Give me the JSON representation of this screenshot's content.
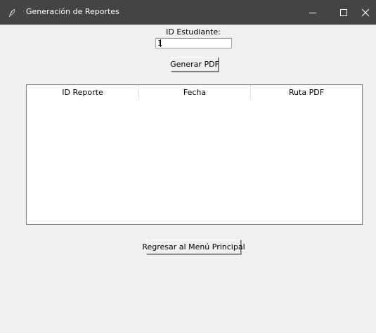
{
  "window": {
    "title": "Generación de Reportes",
    "icon": "feather-icon",
    "controls": [
      "minimize-icon",
      "maximize-icon",
      "close-icon"
    ]
  },
  "form": {
    "id_label": "ID Estudiante:",
    "id_value": "1",
    "generate_button": "Generar PDF"
  },
  "table": {
    "columns": [
      "ID Reporte",
      "Fecha",
      "Ruta PDF"
    ],
    "rows": []
  },
  "footer": {
    "back_button": "Regresar al Menú Principal"
  },
  "colors": {
    "titlebar": "#444444",
    "window_bg": "#f0f0f0",
    "table_bg": "#ffffff"
  }
}
